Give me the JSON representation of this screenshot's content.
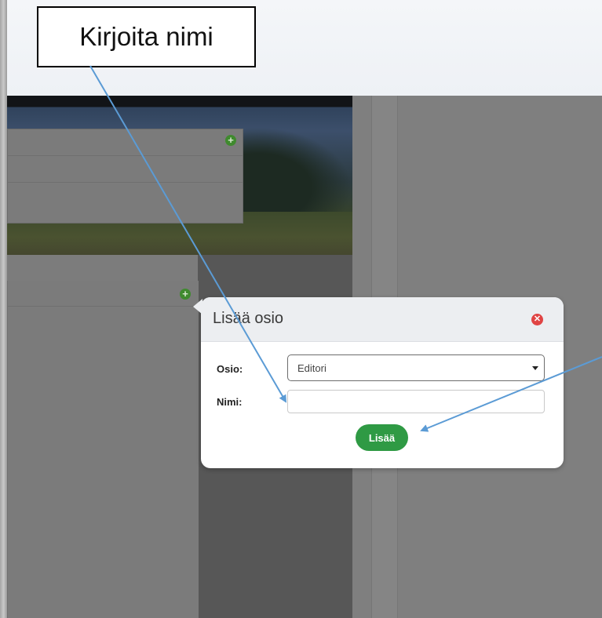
{
  "callout": {
    "text": "Kirjoita nimi"
  },
  "dialog": {
    "title": "Lisää osio",
    "section_label": "Osio:",
    "section_selected": "Editori",
    "name_label": "Nimi:",
    "name_value": "",
    "add_button": "Lisää"
  },
  "icons": {
    "add_widget_1": "plus-circle",
    "add_widget_2": "plus-circle",
    "close": "x-circle"
  },
  "colors": {
    "accent_green": "#2f9a44",
    "close_red": "#e04444",
    "arrow_blue": "#5b9bd5"
  }
}
